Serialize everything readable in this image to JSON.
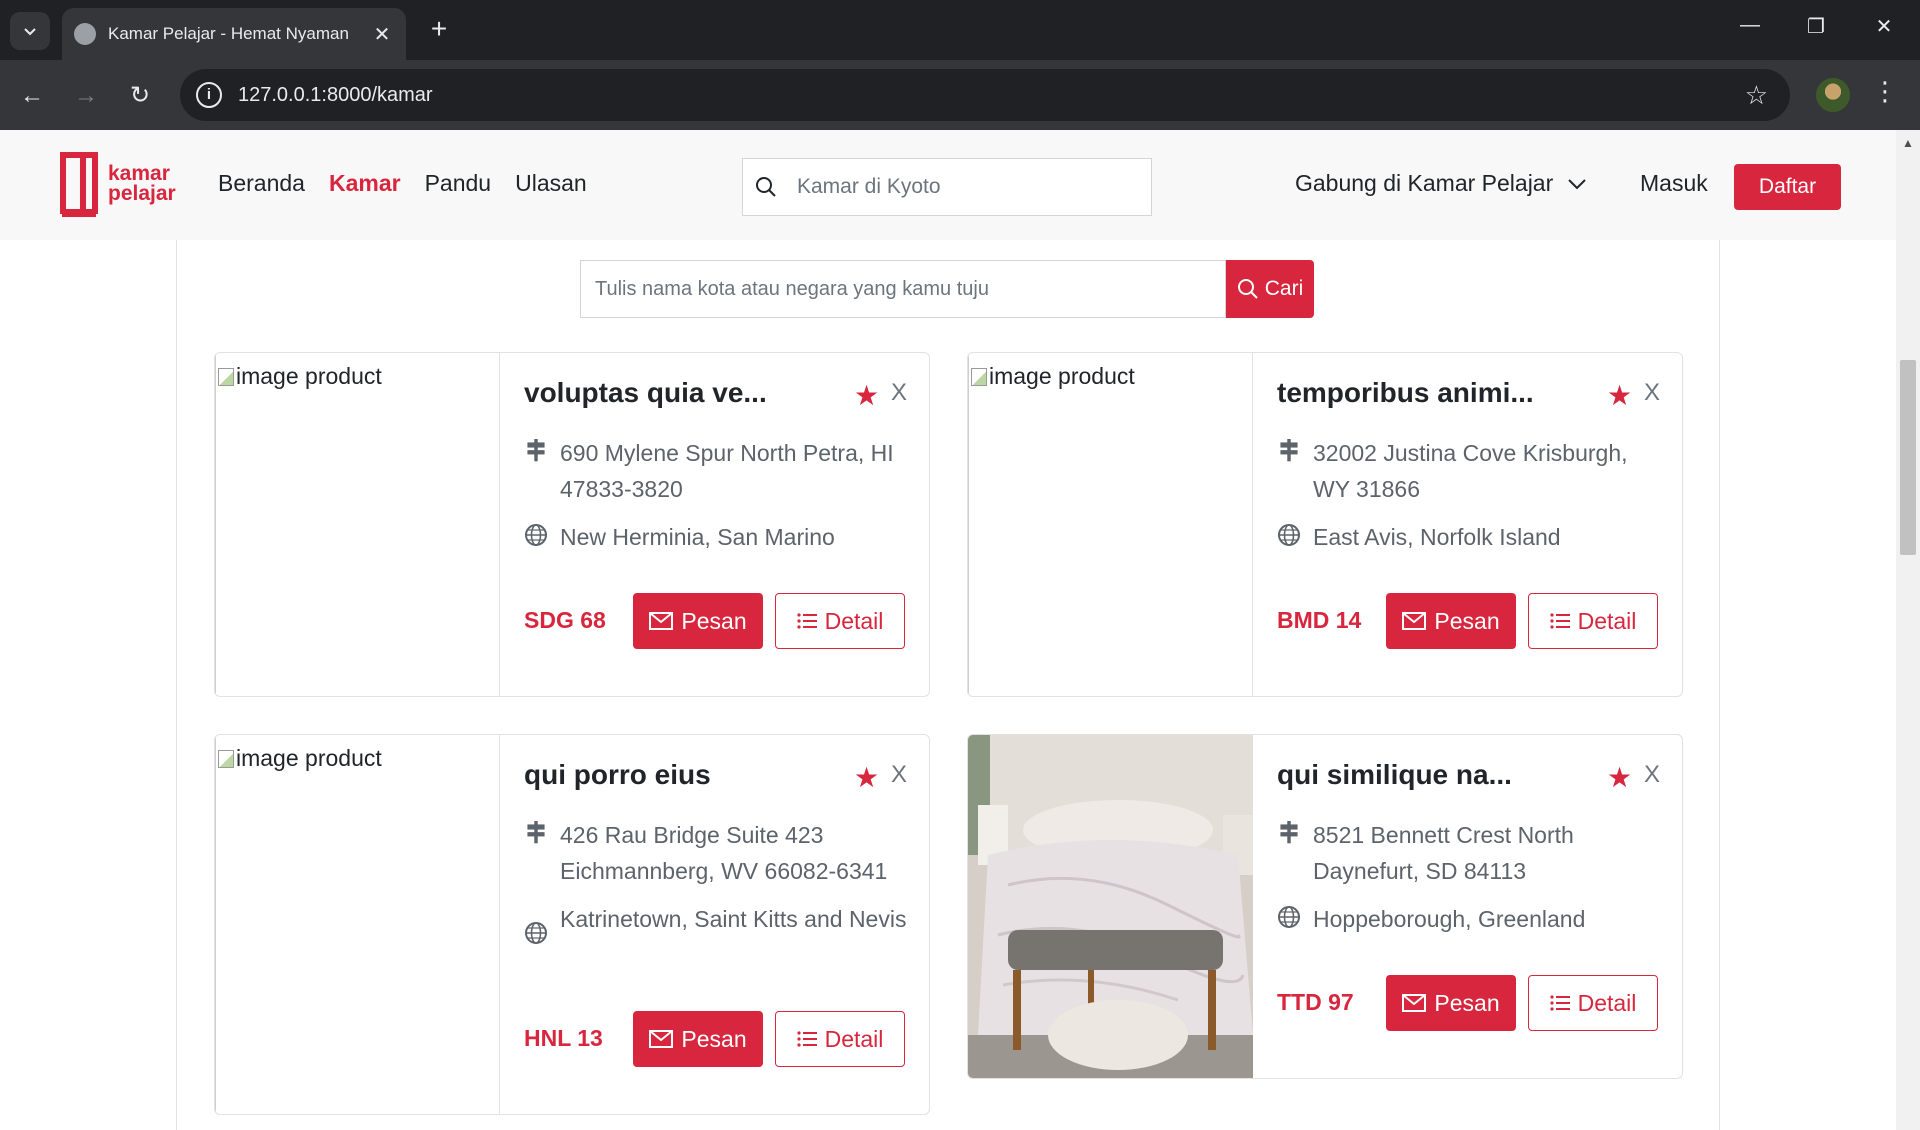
{
  "browser": {
    "tab_title": "Kamar Pelajar - Hemat Nyaman",
    "url": "127.0.0.1:8000/kamar"
  },
  "navbar": {
    "logo_line1": "kamar",
    "logo_line2": "pelajar",
    "links": [
      "Beranda",
      "Kamar",
      "Pandu",
      "Ulasan"
    ],
    "search_placeholder": "Kamar di Kyoto",
    "join_label": "Gabung di Kamar Pelajar",
    "login_label": "Masuk",
    "register_label": "Daftar"
  },
  "search": {
    "placeholder": "Tulis nama kota atau negara yang kamu tuju",
    "button_label": "Cari"
  },
  "card_common": {
    "image_alt": "image product",
    "book_label": "Pesan",
    "detail_label": "Detail",
    "remove_label": "X"
  },
  "rooms": [
    {
      "title": "voluptas quia ve...",
      "address": "690 Mylene Spur North Petra, HI 47833-3820",
      "location": "New Herminia, San Marino",
      "price": "SDG 68"
    },
    {
      "title": "temporibus animi...",
      "address": "32002 Justina Cove Krisburgh, WY 31866",
      "location": "East Avis, Norfolk Island",
      "price": "BMD 14"
    },
    {
      "title": "qui porro eius",
      "address": "426 Rau Bridge Suite 423 Eichmannberg, WV 66082-6341",
      "location": "Katrinetown, Saint Kitts and Nevis",
      "price": "HNL 13"
    },
    {
      "title": "qui similique na...",
      "address": "8521 Bennett Crest North Daynefurt, SD 84113",
      "location": "Hoppeborough, Greenland",
      "price": "TTD 97"
    }
  ]
}
